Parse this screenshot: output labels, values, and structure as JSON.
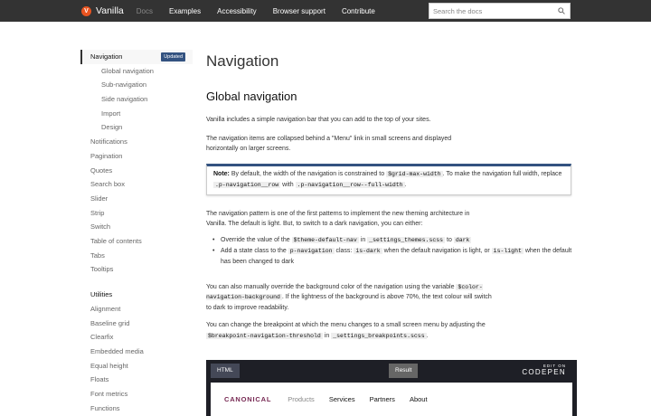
{
  "topnav": {
    "brand": "Vanilla",
    "links": [
      "Docs",
      "Examples",
      "Accessibility",
      "Browser support",
      "Contribute"
    ],
    "search_placeholder": "Search the docs"
  },
  "sidebar": {
    "active": {
      "label": "Navigation",
      "badge": "Updated"
    },
    "sub": [
      "Global navigation",
      "Sub-navigation",
      "Side navigation",
      "Import",
      "Design"
    ],
    "components": [
      "Notifications",
      "Pagination",
      "Quotes",
      "Search box",
      "Slider",
      "Strip",
      "Switch",
      "Table of contents",
      "Tabs",
      "Tooltips"
    ],
    "utilities_heading": "Utilities",
    "utilities": [
      "Alignment",
      "Baseline grid",
      "Clearfix",
      "Embedded media",
      "Equal height",
      "Floats",
      "Font metrics",
      "Functions"
    ]
  },
  "main": {
    "title": "Navigation",
    "section": "Global navigation",
    "p1": "Vanilla includes a simple navigation bar that you can add to the top of your sites.",
    "p2": "The navigation items are collapsed behind a \"Menu\" link in small screens and displayed horizontally on larger screens.",
    "note": {
      "label": "Note:",
      "t1": " By default, the width of the navigation is constrained to ",
      "c1": "$grid-max-width",
      "t2": ". To make the navigation full width, replace ",
      "c2": ".p-navigation__row",
      "t3": " with ",
      "c3": ".p-navigation__row--full-width",
      "t4": "."
    },
    "p3": "The navigation pattern is one of the first patterns to implement the new theming architecture in Vanilla. The default is light. But, to switch to a dark navigation, you can either:",
    "li1": {
      "t1": "Override the value of the ",
      "c1": "$theme-default-nav",
      "t2": " in ",
      "c2": "_settings_themes.scss",
      "t3": " to ",
      "c3": "dark"
    },
    "li2": {
      "t1": "Add a state class to the ",
      "c1": "p-navigation",
      "t2": " class: ",
      "c2": "is-dark",
      "t3": " when the default navigation is light, or ",
      "c3": "is-light",
      "t4": " when the default has been changed to dark"
    },
    "p4": {
      "t1": "You can also manually override the background color of the navigation using the variable ",
      "c1": "$color-navigation-background",
      "t2": ". If the lightness of the background is above 70%, the text colour will switch to dark to improve readability."
    },
    "p5": {
      "t1": "You can change the breakpoint at which the menu changes to a small screen menu by adjusting the ",
      "c1": "$breakpoint-navigation-threshold",
      "t2": " in ",
      "c2": "_settings_breakpoints.scss",
      "t3": "."
    }
  },
  "codepen": {
    "html_tab": "HTML",
    "result_tab": "Result",
    "edit_on": "EDIT ON",
    "name": "CODEPEN",
    "brand": "CANONICAL",
    "links": [
      "Products",
      "Services",
      "Partners",
      "About"
    ]
  }
}
